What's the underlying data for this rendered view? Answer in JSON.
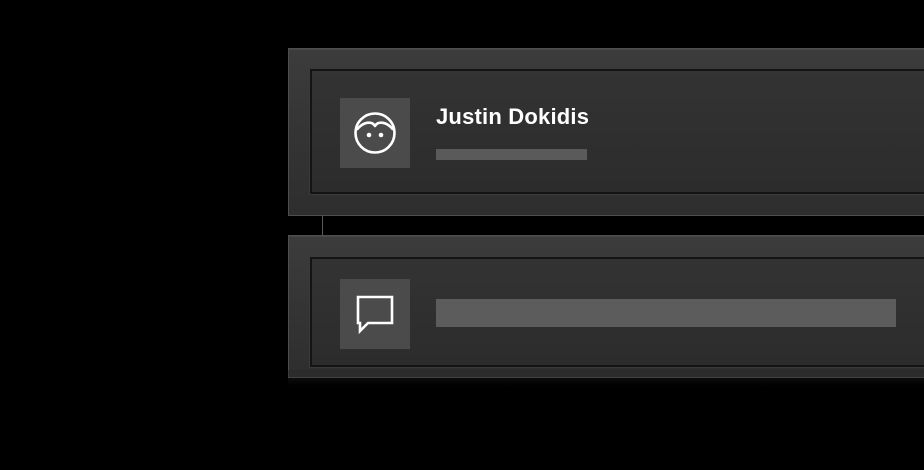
{
  "profile_card": {
    "user_name": "Justin Dokidis",
    "avatar_icon": "face-icon",
    "placeholder_bar": "short-text-placeholder"
  },
  "message_card": {
    "icon": "chat-bubble-icon",
    "placeholder_bar": "long-text-placeholder"
  },
  "colors": {
    "background": "#000000",
    "card": "#383838",
    "tile": "#4b4b4b",
    "placeholder": "#5a5a5a",
    "text": "#ffffff"
  }
}
